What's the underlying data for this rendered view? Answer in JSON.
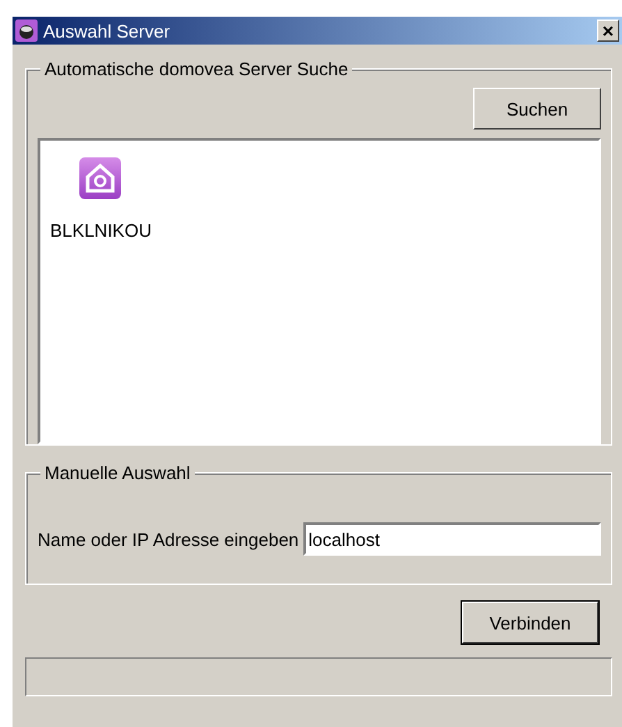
{
  "window": {
    "title": "Auswahl Server",
    "close": "×"
  },
  "auto_search": {
    "title": "Automatische domovea Server Suche",
    "button": "Suchen",
    "servers": [
      {
        "name": "BLKLNIKOU",
        "selected": false
      }
    ]
  },
  "manual": {
    "title": "Manuelle Auswahl",
    "label": "Name oder IP Adresse eingeben",
    "value": "localhost"
  },
  "buttons": [
    "Verbinden"
  ]
}
